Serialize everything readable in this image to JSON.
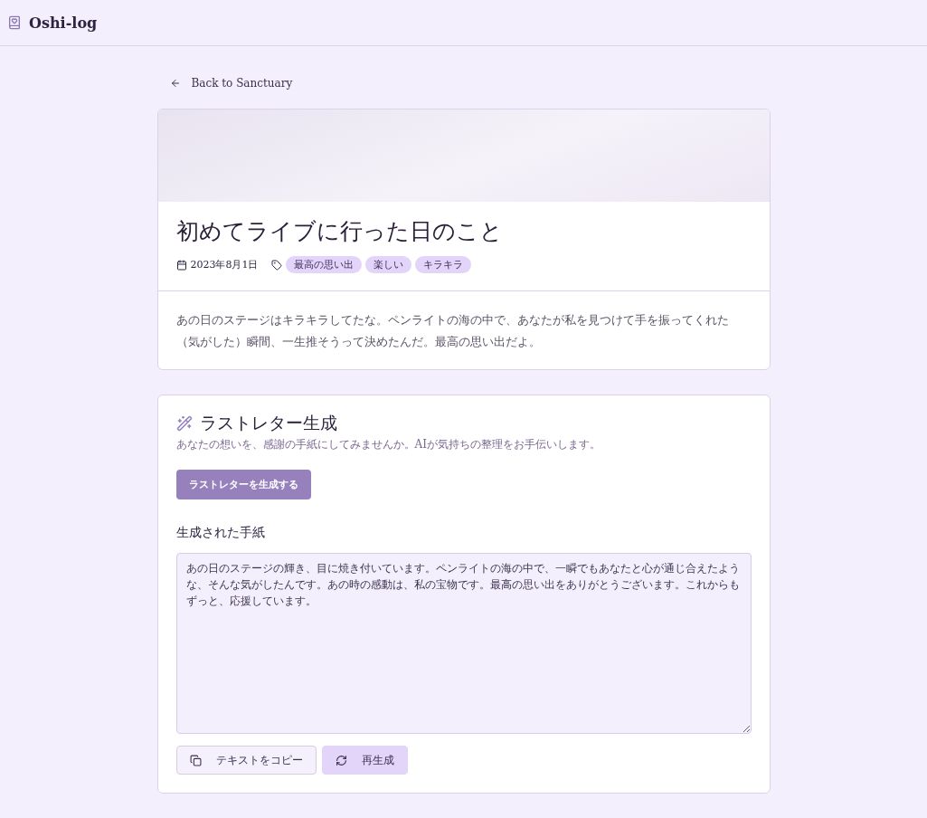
{
  "app": {
    "title": "Oshi-log"
  },
  "back_link": {
    "label": "Back to Sanctuary"
  },
  "entry": {
    "title": "初めてライブに行った日のこと",
    "date": "2023年8月1日",
    "tags": [
      "最高の思い出",
      "楽しい",
      "キラキラ"
    ],
    "body": "あの日のステージはキラキラしてたな。ペンライトの海の中で、あなたが私を見つけて手を振ってくれた（気がした）瞬間、一生推そうって決めたんだ。最高の思い出だよ。"
  },
  "letter": {
    "title": "ラストレター生成",
    "subtitle": "あなたの想いを、感謝の手紙にしてみませんか。AIが気持ちの整理をお手伝いします。",
    "generate_button": "ラストレターを生成する",
    "result_heading": "生成された手紙",
    "result_text": "あの日のステージの輝き、目に焼き付いています。ペンライトの海の中で、一瞬でもあなたと心が通じ合えたような、そんな気がしたんです。あの時の感動は、私の宝物です。最高の思い出をありがとうございます。これからもずっと、応援しています。",
    "actions": [
      {
        "kind": "copy",
        "label": "テキストをコピー"
      },
      {
        "kind": "regenerate",
        "label": "再生成"
      }
    ]
  }
}
